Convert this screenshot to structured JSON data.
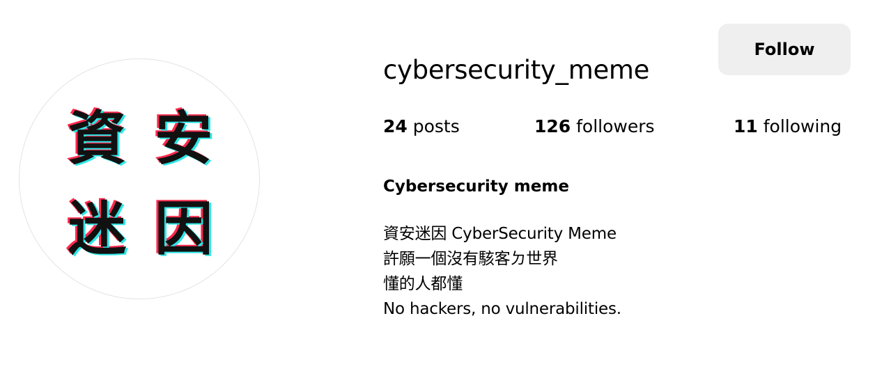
{
  "profile": {
    "username": "cybersecurity_meme",
    "follow_label": "Follow",
    "avatar_chars": [
      "資",
      "安",
      "迷",
      "因"
    ],
    "full_name": "Cybersecurity meme"
  },
  "stats": {
    "posts_count": "24",
    "posts_label": " posts",
    "followers_count": "126",
    "followers_label": " followers",
    "following_count": "11",
    "following_label": " following"
  },
  "bio": {
    "lines": [
      "資安迷因 CyberSecurity Meme",
      "許願一個沒有駭客ㄉ世界",
      "懂的人都懂",
      "No hackers, no vulnerabilities."
    ]
  },
  "colors": {
    "button_bg": "#efefef",
    "avatar_glitch_red": "#ff2a4f",
    "avatar_glitch_cyan": "#2ee6e6",
    "avatar_text": "#111111"
  }
}
